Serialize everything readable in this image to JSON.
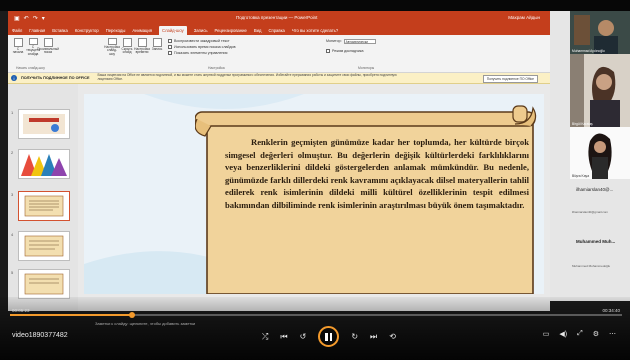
{
  "app": {
    "title_bar": "Подготовка презентации — PowerPoint",
    "user": "Махрам Айдын",
    "quick_access": [
      "▣",
      "↶",
      "↷",
      "▾"
    ]
  },
  "ribbon": {
    "tabs": [
      "Файл",
      "Главная",
      "Вставка",
      "Конструктор",
      "Переходы",
      "Анимация",
      "Слайд-шоу",
      "Запись",
      "Рецензирование",
      "Вид",
      "Справка",
      "Что вы хотите сделать?"
    ],
    "active_tab_index": 6,
    "groups": {
      "start": [
        "С начала",
        "С текущего слайда",
        "Произвольный показ"
      ],
      "setup": [
        "Настройка слайд-шоу",
        "Скрыть слайд",
        "Настройка времени",
        "Запись"
      ],
      "checks": [
        "Воспроизвести закадровый текст",
        "Использовать время показа слайдов",
        "Показать элементы управления"
      ],
      "monitor_label": "Монитор:",
      "monitor_value": "Автоматически",
      "presenter_view": "Режим докладчика",
      "group_labels": [
        "Начать слайд-шоу",
        "Настройка",
        "Мониторы"
      ]
    }
  },
  "infobar": {
    "title": "ПОЛУЧИТЬ ПОДЛИННОЕ ПО OFFICE",
    "message": "Ваша лицензия на Office не является подлинной, и вы можете стать жертвой подделки программного обеспечения. Избегайте прерывания работы и защитите свои файлы, приобретя подлинную лицензию Office.",
    "button": "Получить подлинное ПО Office"
  },
  "slides": {
    "numbers": [
      "1",
      "2",
      "3",
      "4",
      "5"
    ],
    "selected_index": 2,
    "main_text": "Renklerin geçmişten günümüze kadar her toplumda, her kültürde birçok simgesel değerleri olmuştur. Bu değerlerin değişik kültürlerdeki farklılıklarını veya benzerliklerini dildeki göstergelerden anlamak mümkündür. Bu nedenle, günümüzde farklı dillerdeki renk kavramını açıklayacak dilsel materyallerin tahlil edilerek renk isimlerinin dildeki milli kültürel özelliklerinin tespit edilmesi bakımından dilbiliminde renk isimlerinin araştırılması büyük önem taşımaktadır."
  },
  "player": {
    "video_name": "video1890377482",
    "time_elapsed": "00:05:23",
    "time_total": "00:34:40",
    "progress": 0.2,
    "caption": "Заметки к слайду: щелкните, чтобы добавить заметки",
    "icons": [
      "shuffle-icon",
      "previous-icon",
      "rewind-icon",
      "pause-icon",
      "forward-icon",
      "next-icon",
      "repeat-icon"
    ],
    "accent": "#f39a2c"
  },
  "participants": {
    "names": [
      "Muhammad Aydınoğlu",
      "Birgül Karataş",
      "ilhamiarslan40@gmail.com",
      "Muhammed Muh..."
    ],
    "short_names": [
      "Büşra Kaya",
      "ilhamiarslan40@...",
      "Muhammed Muh..."
    ],
    "email": "ilhamiarslan40@gmail.com",
    "sub": "Muhammed Muhammedoğlu"
  }
}
